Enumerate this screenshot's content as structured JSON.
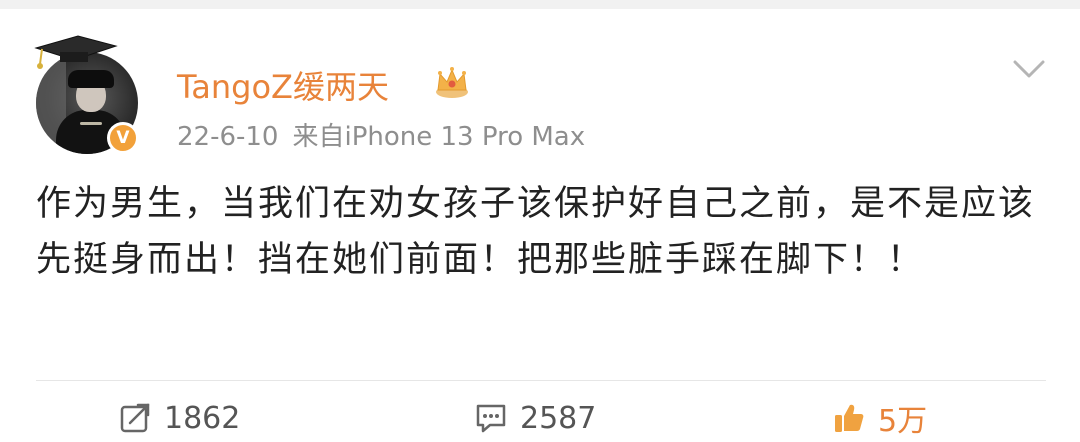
{
  "post": {
    "username": "TangoZ缓两天",
    "date": "22-6-10",
    "source": "来自iPhone 13 Pro Max",
    "text": "作为男生，当我们在劝女孩子该保护好自己之前，是不是应该先挺身而出！挡在她们前面！把那些脏手踩在脚下！！",
    "verified_badge": "V",
    "username_color": "#e8833a",
    "badge_color": "#f2a13a"
  },
  "actions": {
    "repost_count": "1862",
    "comment_count": "2587",
    "like_count": "5万"
  },
  "icons": {
    "more": "chevron-down-icon",
    "repost": "repost-icon",
    "comment": "comment-icon",
    "like": "thumbs-up-icon",
    "member": "crown-icon"
  }
}
